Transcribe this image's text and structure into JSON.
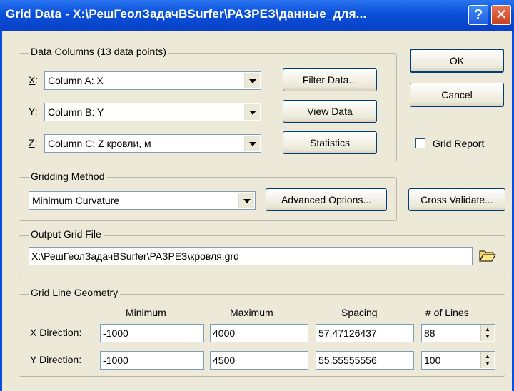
{
  "window": {
    "title": "Grid Data - X:\\РешГеолЗадачВSurfer\\РАЗРЕЗ\\данные_для..."
  },
  "icons": {
    "help": "help-icon",
    "close": "close-icon",
    "open_folder": "open-folder-icon"
  },
  "data_columns": {
    "legend": "Data Columns    (13 data points)",
    "x": {
      "key": "X",
      "label": ":",
      "value": "Column A:  X"
    },
    "y": {
      "key": "Y",
      "label": ":",
      "value": "Column B:  Y"
    },
    "z": {
      "key": "Z",
      "label": ":",
      "value": "Column C:  Z кровли, м"
    },
    "filter_button": "Filter Data...",
    "view_button": "View Data",
    "statistics_button": "Statistics"
  },
  "buttons": {
    "ok": "OK",
    "cancel": "Cancel",
    "cross_validate": "Cross Validate..."
  },
  "grid_report": {
    "label": "Grid Report",
    "checked": false
  },
  "gridding_method": {
    "legend": "Gridding Method",
    "value": "Minimum Curvature",
    "advanced_button": "Advanced Options..."
  },
  "output_grid_file": {
    "legend": "Output Grid File",
    "value": "X:\\РешГеолЗадачВSurfer\\РАЗРЕЗ\\кровля.grd"
  },
  "geometry": {
    "legend": "Grid Line Geometry",
    "headers": {
      "minimum": "Minimum",
      "maximum": "Maximum",
      "spacing": "Spacing",
      "lines": "# of Lines"
    },
    "x": {
      "label": "X Direction:",
      "minimum": "-1000",
      "maximum": "4000",
      "spacing": "57.47126437",
      "lines": "88"
    },
    "y": {
      "label": "Y Direction:",
      "minimum": "-1000",
      "maximum": "4500",
      "spacing": "55.55555556",
      "lines": "100"
    }
  }
}
